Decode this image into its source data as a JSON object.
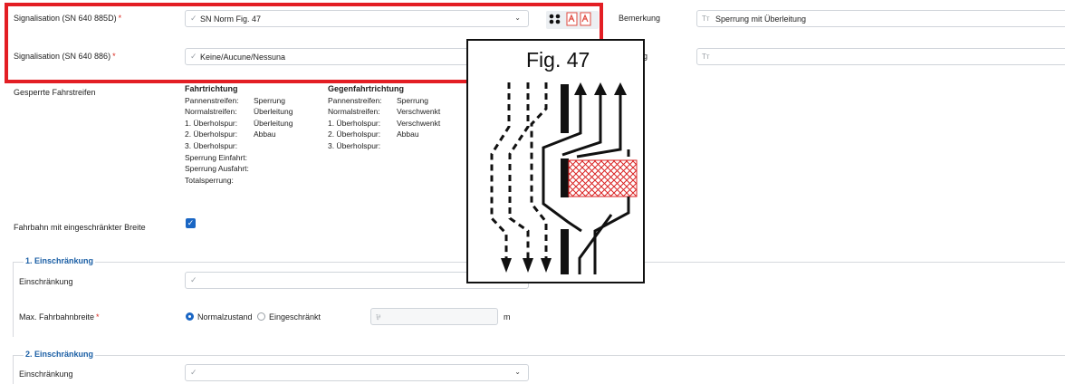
{
  "signalisation_885d": {
    "label": "Signalisation (SN 640 885D)",
    "required": "*",
    "value": "SN Norm Fig. 47"
  },
  "signalisation_886": {
    "label": "Signalisation (SN 640 886)",
    "required": "*",
    "value": "Keine/Aucune/Nessuna"
  },
  "bemerkung": {
    "label": "Bemerkung",
    "value": "Sperrung mit Überleitung",
    "placeholder_icon": "Tт"
  },
  "second_remark": {
    "label_partial": "g",
    "placeholder_icon": "Tт"
  },
  "gesperrte": {
    "label": "Gesperrte Fahrstreifen",
    "fahrtrichtung": {
      "header": "Fahrtrichtung",
      "rows": [
        {
          "k": "Pannenstreifen:",
          "v": "Sperrung"
        },
        {
          "k": "Normalstreifen:",
          "v": "Überleitung"
        },
        {
          "k": "1. Überholspur:",
          "v": "Überleitung"
        },
        {
          "k": "2. Überholspur:",
          "v": "Abbau"
        },
        {
          "k": "3. Überholspur:",
          "v": ""
        },
        {
          "k": "Sperrung Einfahrt:",
          "v": ""
        },
        {
          "k": "Sperrung Ausfahrt:",
          "v": ""
        },
        {
          "k": "Totalsperrung:",
          "v": ""
        }
      ]
    },
    "gegenfahrtrichtung": {
      "header": "Gegenfahrtrichtung",
      "rows": [
        {
          "k": "Pannenstreifen:",
          "v": "Sperrung"
        },
        {
          "k": "Normalstreifen:",
          "v": "Verschwenkt"
        },
        {
          "k": "1. Überholspur:",
          "v": "Verschwenkt"
        },
        {
          "k": "2. Überholspur:",
          "v": "Abbau"
        },
        {
          "k": "3. Überholspur:",
          "v": ""
        }
      ]
    }
  },
  "fahrbahn": {
    "label": "Fahrbahn mit eingeschränkter Breite",
    "checked": true,
    "check_glyph": "✓"
  },
  "einschraenkung1": {
    "title": "1. Einschränkung",
    "einschraenkung_label": "Einschränkung",
    "breite_label": "Max. Fahrbahnbreite",
    "required": "*",
    "radio_normal": "Normalzustand",
    "radio_eingeschraenkt": "Eingeschränkt",
    "selected": "Normalzustand",
    "unit": "m"
  },
  "einschraenkung2": {
    "title": "2. Einschränkung",
    "einschraenkung_label": "Einschränkung"
  },
  "figure": {
    "caption": "Fig. 47"
  },
  "icons": {
    "check": "✓",
    "chevron": "⌄",
    "braille": "⠿"
  },
  "colors": {
    "highlight": "#e31e24",
    "accent": "#1a66c4",
    "section_title": "#1b5fa5"
  }
}
